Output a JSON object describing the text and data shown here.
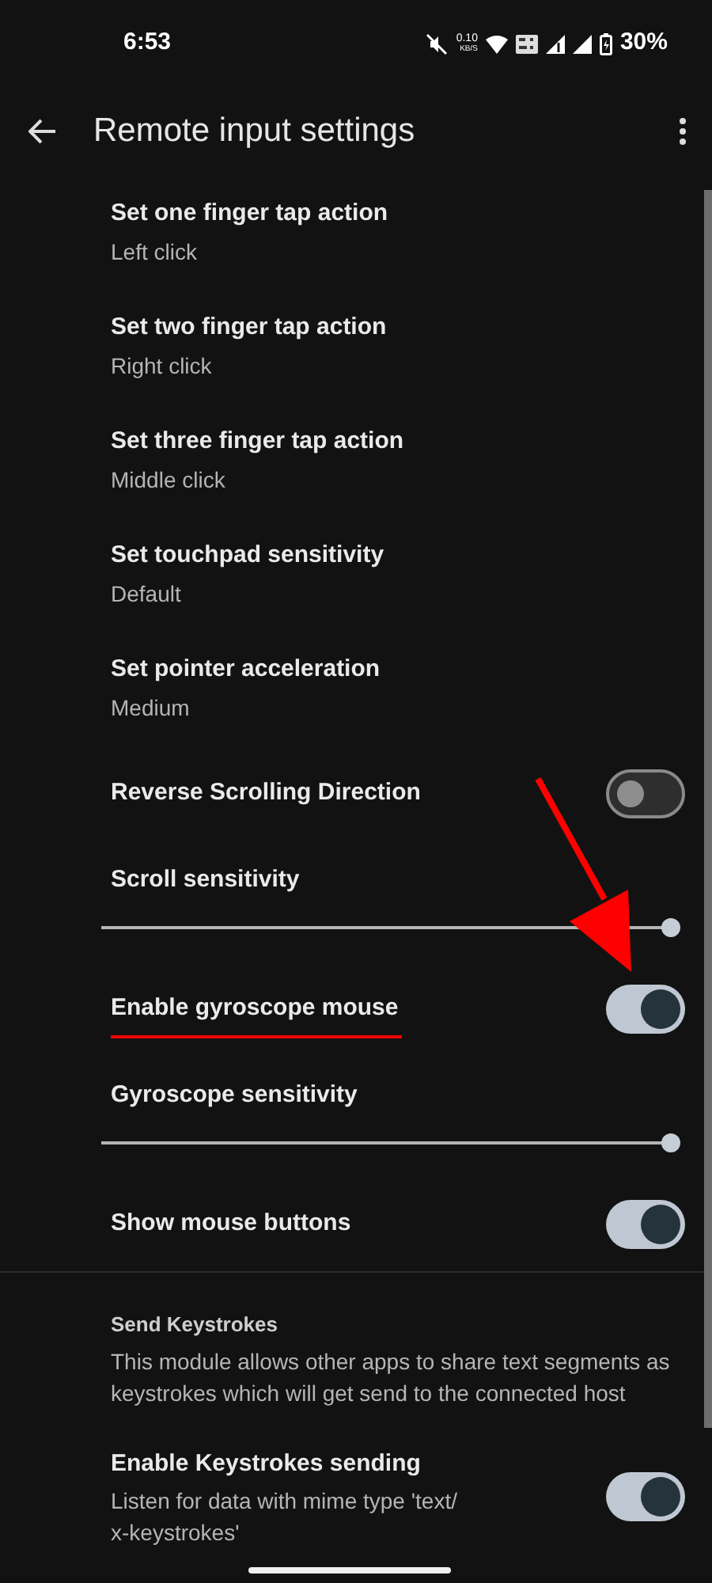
{
  "status_bar": {
    "time": "6:53",
    "net_speed": "0.10",
    "net_unit": "KB/S",
    "battery": "30%"
  },
  "app_bar": {
    "title": "Remote input settings"
  },
  "items": [
    {
      "kind": "option",
      "title": "Set one finger tap action",
      "summary": "Left click"
    },
    {
      "kind": "option",
      "title": "Set two finger tap action",
      "summary": "Right click"
    },
    {
      "kind": "option",
      "title": "Set three finger tap action",
      "summary": "Middle click"
    },
    {
      "kind": "option",
      "title": "Set touchpad sensitivity",
      "summary": "Default"
    },
    {
      "kind": "option",
      "title": "Set pointer acceleration",
      "summary": "Medium"
    },
    {
      "kind": "switch",
      "title": "Reverse Scrolling Direction",
      "on": false
    },
    {
      "kind": "slider",
      "title": "Scroll sensitivity",
      "level": 1
    },
    {
      "kind": "switch",
      "title": "Enable gyroscope mouse",
      "on": true,
      "highlighted": true
    },
    {
      "kind": "slider",
      "title": "Gyroscope sensitivity",
      "level": 1
    },
    {
      "kind": "switch",
      "title": "Show mouse buttons",
      "on": true
    },
    {
      "kind": "category",
      "title": "Send Keystrokes",
      "summary": "This module allows other apps to share text segments as keystrokes which will get send to the connected host"
    },
    {
      "kind": "switch",
      "title": "Enable Keystrokes sending",
      "summary": "Listen for data with mime type 'text/ x-keystrokes'",
      "on": true
    }
  ]
}
